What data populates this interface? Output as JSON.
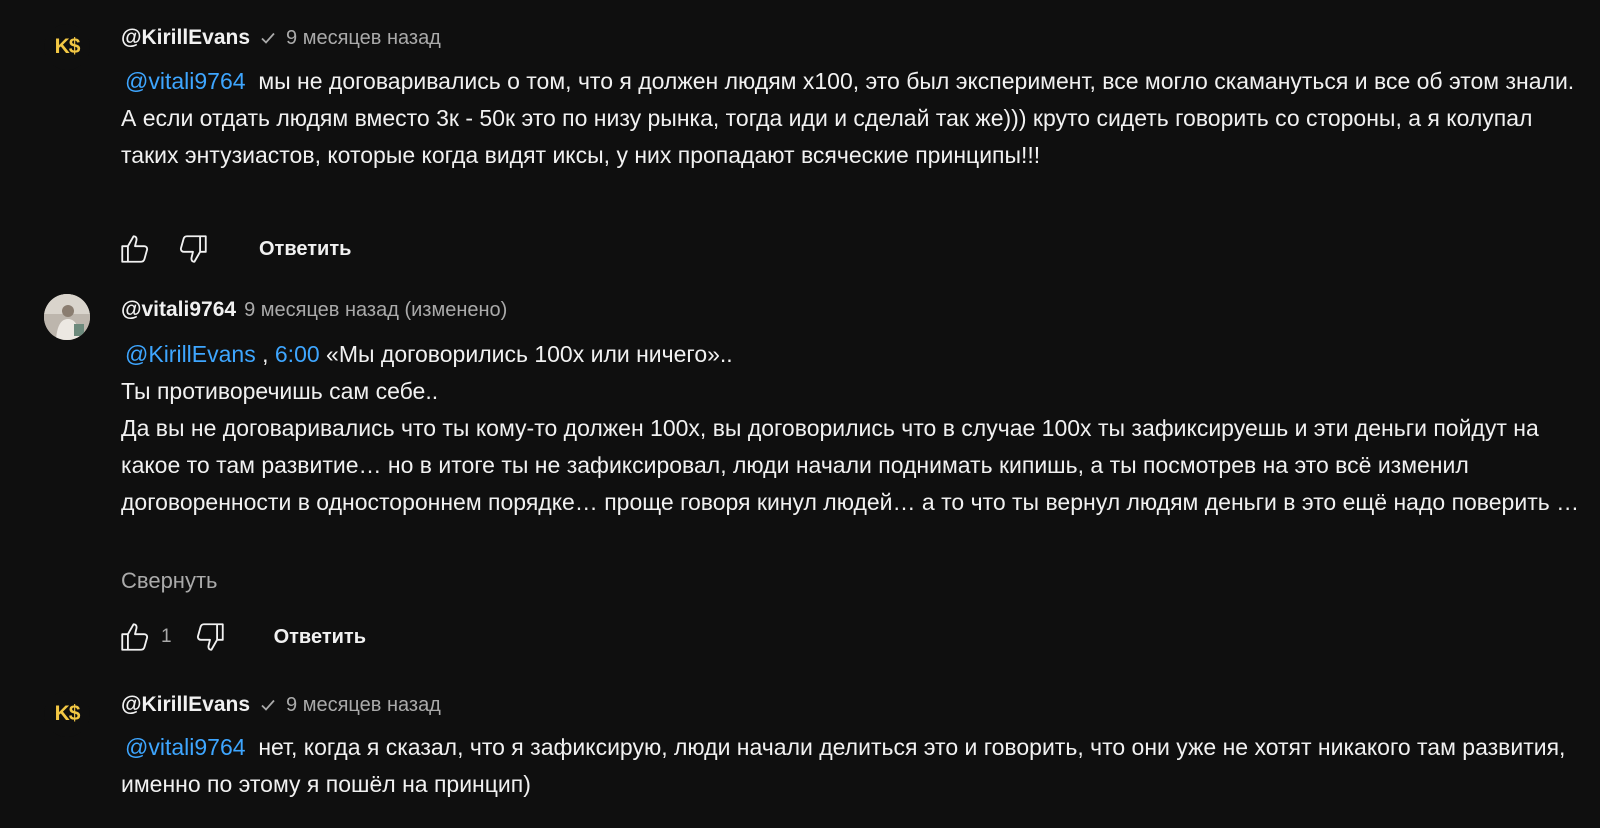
{
  "comments": [
    {
      "avatar_text": "K$",
      "author": "@KirillEvans",
      "time": "9 месяцев назад",
      "mention": "@vitali9764",
      "text": "мы не договаривались о том, что я должен людям х100, это был эксперимент, все могло скамануться и все об этом знали. А если отдать людям вместо 3к - 50к это по низу рынка, тогда иди и сделай так же))) круто сидеть говорить со стороны, а я колупал таких энтузиастов, которые когда видят иксы, у них пропадают всяческие принципы!!!",
      "reply_label": "Ответить"
    },
    {
      "author": "@vitali9764",
      "time": "9 месяцев назад (изменено)",
      "mention": "@KirillEvans",
      "separator": " , ",
      "timestamp_link": "6:00",
      "line1_rest": " «Мы договорились 100х или ничего»..",
      "line2": "Ты противоречишь сам себе..",
      "line3": "Да вы не договаривались что ты кому-то  должен 100х, вы договорились что в случае 100х ты зафиксируешь и эти деньги пойдут на какое то там развитие… но в итоге ты не зафиксировал, люди начали поднимать кипишь, а ты посмотрев на это всё изменил договоренности в одностороннем порядке… проще говоря кинул людей… а то что ты вернул людям деньги в это ещё надо поверить …",
      "collapse_label": "Свернуть",
      "like_count": "1",
      "reply_label": "Ответить"
    },
    {
      "avatar_text": "K$",
      "author": "@KirillEvans",
      "time": "9 месяцев назад",
      "mention": "@vitali9764",
      "text": "нет, когда я сказал, что я зафиксирую, люди начали делиться это и говорить, что они уже не хотят никакого там развития, именно по этому я пошёл на принцип)"
    }
  ]
}
